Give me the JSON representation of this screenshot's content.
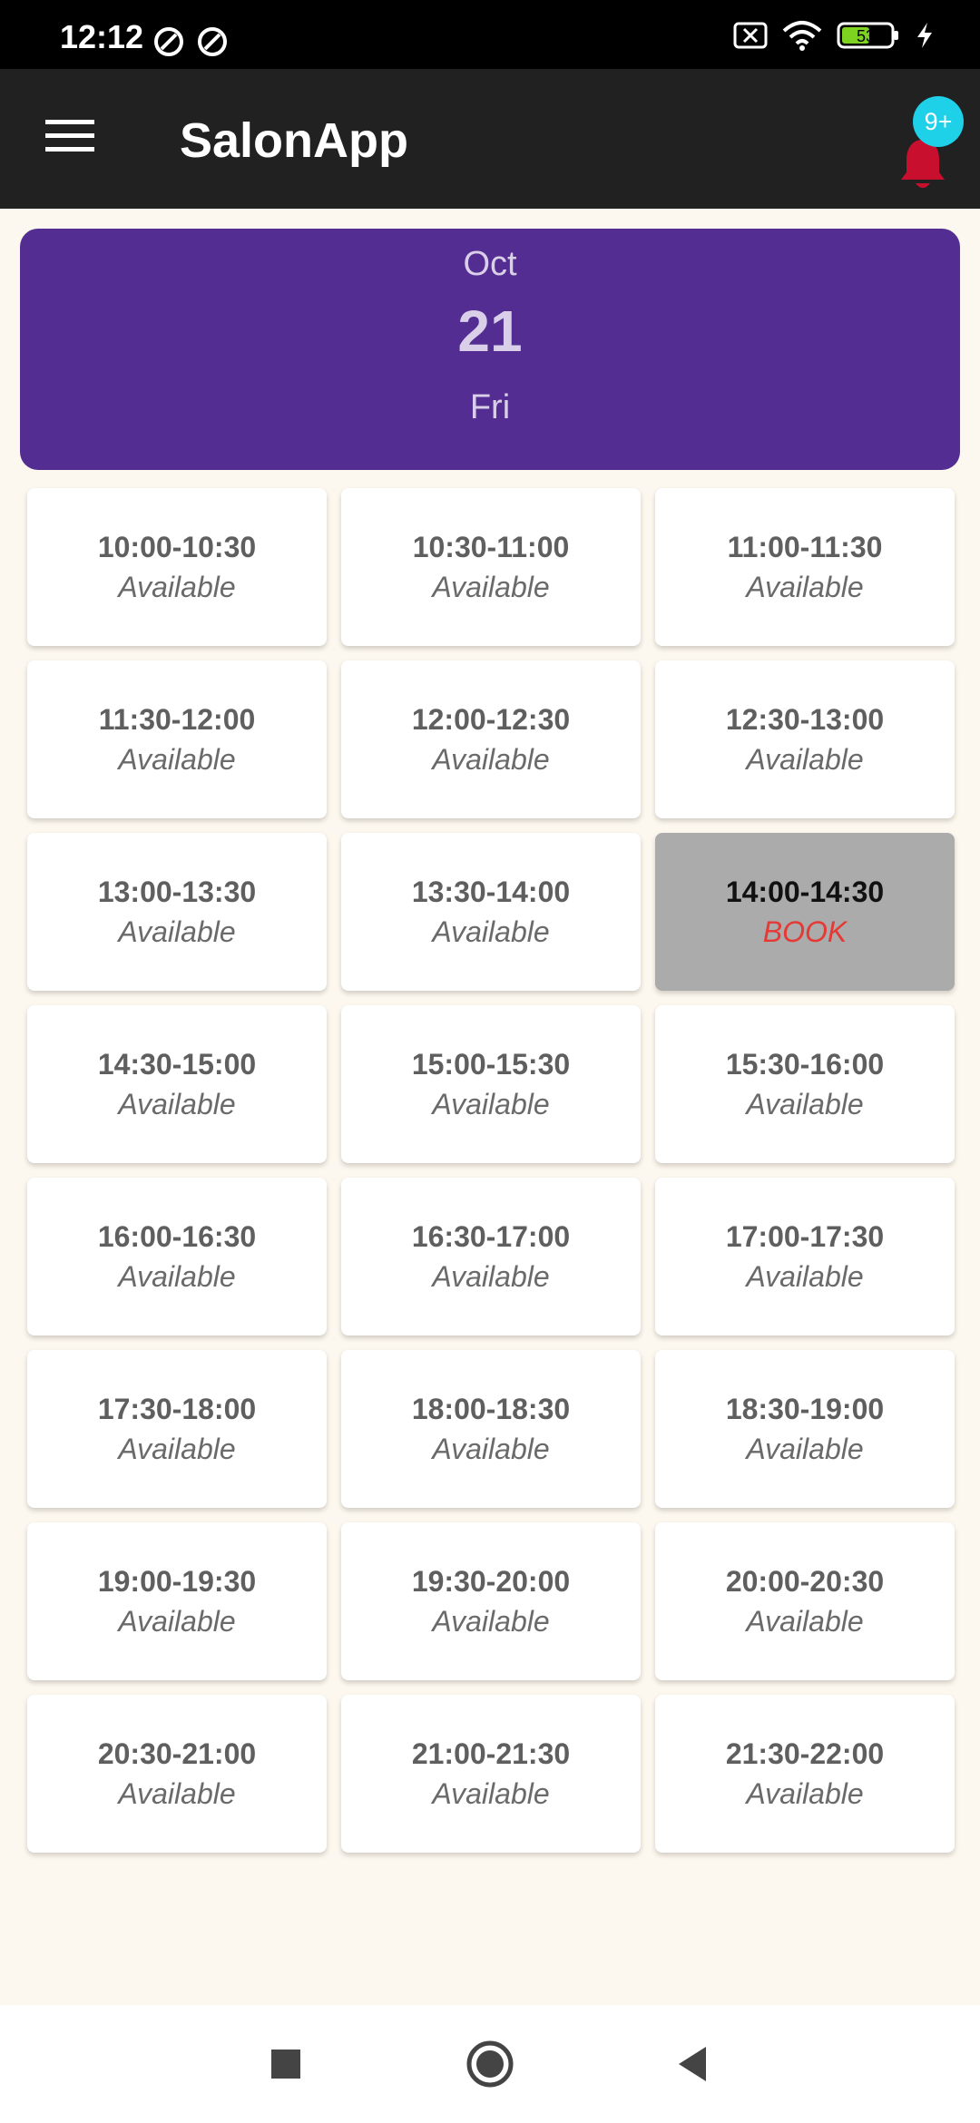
{
  "status_bar": {
    "time": "12:12",
    "battery": "53"
  },
  "app_bar": {
    "title": "SalonApp",
    "notification_badge": "9+"
  },
  "date_card": {
    "month": "Oct",
    "day": "21",
    "weekday": "Fri"
  },
  "slots": [
    {
      "time": "10:00-10:30",
      "status": "Available"
    },
    {
      "time": "10:30-11:00",
      "status": "Available"
    },
    {
      "time": "11:00-11:30",
      "status": "Available"
    },
    {
      "time": "11:30-12:00",
      "status": "Available"
    },
    {
      "time": "12:00-12:30",
      "status": "Available"
    },
    {
      "time": "12:30-13:00",
      "status": "Available"
    },
    {
      "time": "13:00-13:30",
      "status": "Available"
    },
    {
      "time": "13:30-14:00",
      "status": "Available"
    },
    {
      "time": "14:00-14:30",
      "status": "BOOK"
    },
    {
      "time": "14:30-15:00",
      "status": "Available"
    },
    {
      "time": "15:00-15:30",
      "status": "Available"
    },
    {
      "time": "15:30-16:00",
      "status": "Available"
    },
    {
      "time": "16:00-16:30",
      "status": "Available"
    },
    {
      "time": "16:30-17:00",
      "status": "Available"
    },
    {
      "time": "17:00-17:30",
      "status": "Available"
    },
    {
      "time": "17:30-18:00",
      "status": "Available"
    },
    {
      "time": "18:00-18:30",
      "status": "Available"
    },
    {
      "time": "18:30-19:00",
      "status": "Available"
    },
    {
      "time": "19:00-19:30",
      "status": "Available"
    },
    {
      "time": "19:30-20:00",
      "status": "Available"
    },
    {
      "time": "20:00-20:30",
      "status": "Available"
    },
    {
      "time": "20:30-21:00",
      "status": "Available"
    },
    {
      "time": "21:00-21:30",
      "status": "Available"
    },
    {
      "time": "21:30-22:00",
      "status": "Available"
    }
  ],
  "colors": {
    "app_bar": "#212121",
    "date_card": "#532d91",
    "selected_slot": "#ababab",
    "book_text": "#e53935",
    "badge": "#1ed0e8",
    "bell": "#c8102e"
  },
  "icons": {
    "menu": "menu-icon",
    "notification": "bell-icon",
    "nav_recents": "square-icon",
    "nav_home": "circle-icon",
    "nav_back": "back-triangle-icon"
  }
}
